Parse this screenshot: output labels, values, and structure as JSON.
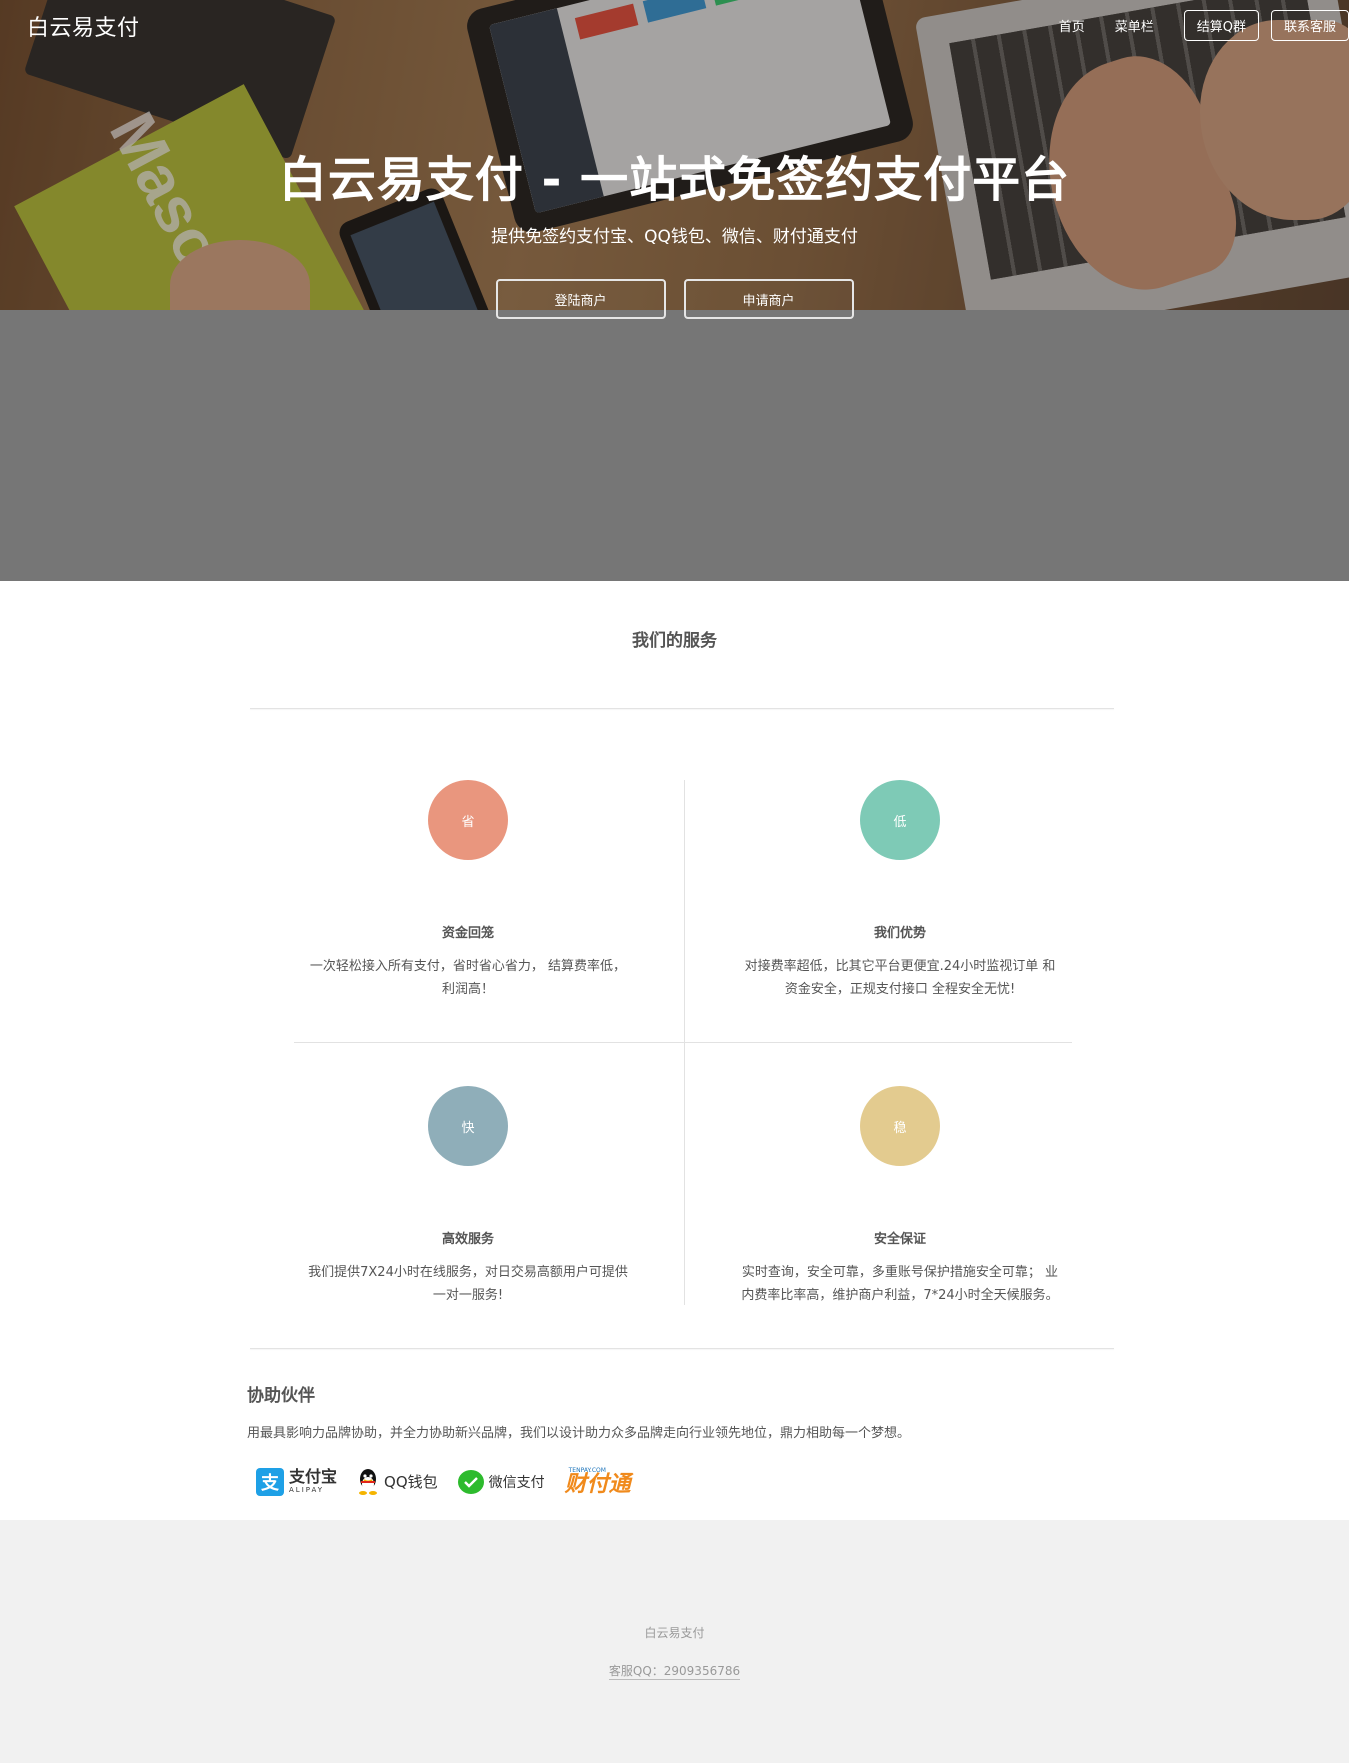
{
  "brand": "白云易支付",
  "nav": {
    "home": "首页",
    "menu": "菜单栏",
    "qq_group": "结算Q群",
    "support": "联系客服"
  },
  "hero": {
    "title": "白云易支付 - 一站式免签约支付平台",
    "subtitle": "提供免签约支付宝、QQ钱包、微信、财付通支付",
    "login_button": "登陆商户",
    "register_button": "申请商户",
    "photo_book_text": "Maso"
  },
  "services": {
    "title": "我们的服务",
    "items": [
      {
        "badge": "省",
        "title": "资金回笼",
        "desc_line1": "一次轻松接入所有支付，省时省心省力， 结算费率低，",
        "desc_line2": "利润高！",
        "color": "#e9967e"
      },
      {
        "badge": "低",
        "title": "我们优势",
        "desc_line1": "对接费率超低，比其它平台更便宜.24小时监视订单 和",
        "desc_line2": "资金安全，正规支付接口 全程安全无忧!",
        "color": "#7ecab6"
      },
      {
        "badge": "快",
        "title": "高效服务",
        "desc_line1": "我们提供7X24小时在线服务，对日交易高额用户可提供",
        "desc_line2": "一对一服务!",
        "color": "#8faeb9"
      },
      {
        "badge": "稳",
        "title": "安全保证",
        "desc_line1": "实时查询，安全可靠，多重账号保护措施安全可靠； 业",
        "desc_line2": "内费率比率高，维护商户利益，7*24小时全天候服务。",
        "color": "#e3cb8f"
      }
    ]
  },
  "partners": {
    "title": "协助伙伴",
    "desc": "用最具影响力品牌协助，并全力协助新兴品牌，我们以设计助力众多品牌走向行业领先地位，鼎力相助每一个梦想。",
    "alipay_mark": "支",
    "alipay_cn": "支付宝",
    "alipay_en": "ALIPAY",
    "qq_wallet": "QQ钱包",
    "wechat_pay": "微信支付",
    "tenpay_small": "TENPAY.COM",
    "tenpay_big": "财付通"
  },
  "footer": {
    "name": "白云易支付",
    "qq": "客服QQ：2909356786"
  }
}
